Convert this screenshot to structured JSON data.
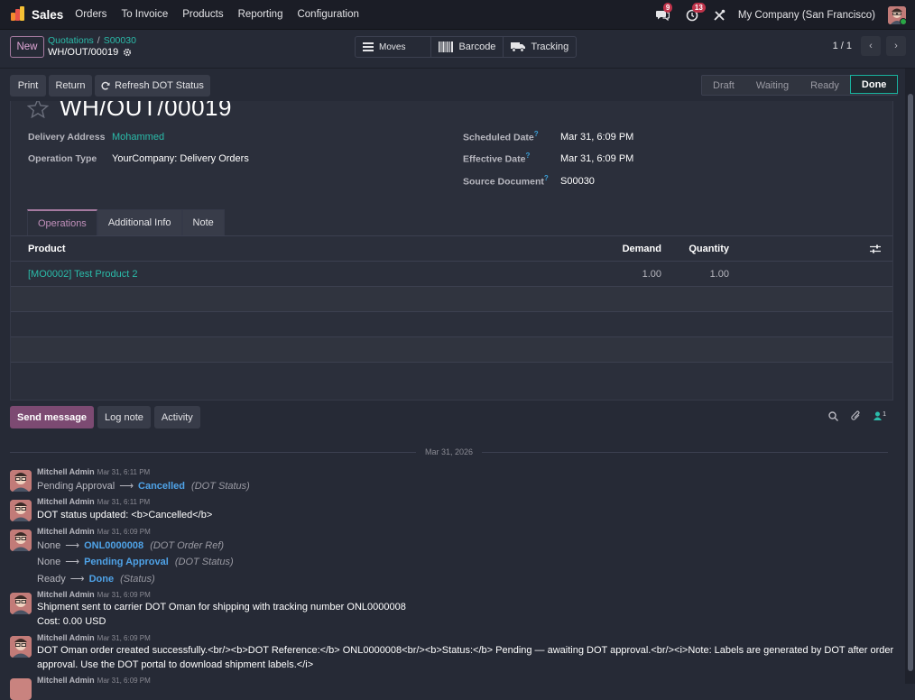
{
  "topbar": {
    "app_name": "Sales",
    "menu": [
      "Orders",
      "To Invoice",
      "Products",
      "Reporting",
      "Configuration"
    ],
    "messages_count": "9",
    "activities_count": "13",
    "company": "My Company (San Francisco)"
  },
  "control": {
    "new_label": "New",
    "breadcrumb": [
      "Quotations",
      "S00030"
    ],
    "record_name": "WH/OUT/00019",
    "smart_buttons": [
      "Moves",
      "Barcode",
      "Tracking"
    ],
    "pager": "1 / 1"
  },
  "actions": {
    "print": "Print",
    "return": "Return",
    "refresh": "Refresh DOT Status"
  },
  "status": {
    "stages": [
      "Draft",
      "Waiting",
      "Ready",
      "Done"
    ],
    "current": "Done"
  },
  "form": {
    "title": "WH/OUT/00019",
    "delivery_address_label": "Delivery Address",
    "delivery_address": "Mohammed",
    "operation_type_label": "Operation Type",
    "operation_type": "YourCompany: Delivery Orders",
    "scheduled_date_label": "Scheduled Date",
    "scheduled_date": "Mar 31, 6:09 PM",
    "effective_date_label": "Effective Date",
    "effective_date": "Mar 31, 6:09 PM",
    "source_document_label": "Source Document",
    "source_document": "S00030",
    "help_mark": "?"
  },
  "tabs": [
    "Operations",
    "Additional Info",
    "Note"
  ],
  "operations": {
    "headers": [
      "Product",
      "Demand",
      "Quantity"
    ],
    "rows": [
      {
        "product": "[MO0002] Test Product 2",
        "demand": "1.00",
        "quantity": "1.00"
      }
    ]
  },
  "chatter": {
    "send_message": "Send message",
    "log_note": "Log note",
    "activity": "Activity",
    "followers_count": "1",
    "date_separator": "Mar 31, 2026",
    "messages": [
      {
        "author": "Mitchell Admin",
        "time": "Mar 31, 6:11 PM",
        "old": "Pending Approval",
        "new": "Cancelled",
        "field": "(DOT Status)"
      },
      {
        "author": "Mitchell Admin",
        "time": "Mar 31, 6:11 PM",
        "body": "DOT status updated: <b>Cancelled</b>"
      },
      {
        "author": "Mitchell Admin",
        "time": "Mar 31, 6:09 PM",
        "tracking": [
          {
            "old": "None",
            "new": "ONL0000008",
            "field": "(DOT Order Ref)"
          },
          {
            "old": "None",
            "new": "Pending Approval",
            "field": "(DOT Status)"
          },
          {
            "old": "Ready",
            "new": "Done",
            "field": "(Status)"
          }
        ]
      },
      {
        "author": "Mitchell Admin",
        "time": "Mar 31, 6:09 PM",
        "body": "Shipment sent to carrier DOT Oman for shipping with tracking number ONL0000008",
        "body2": "Cost: 0.00 USD"
      },
      {
        "author": "Mitchell Admin",
        "time": "Mar 31, 6:09 PM",
        "body": "DOT Oman order created successfully.<br/><b>DOT Reference:</b> ONL0000008<br/><b>Status:</b> Pending — awaiting DOT approval.<br/><i>Note: Labels are generated by DOT after order",
        "body2": "approval. Use the DOT portal to download shipment labels.</i>"
      },
      {
        "author": "Mitchell Admin",
        "time": "Mar 31, 6:09 PM"
      }
    ]
  }
}
